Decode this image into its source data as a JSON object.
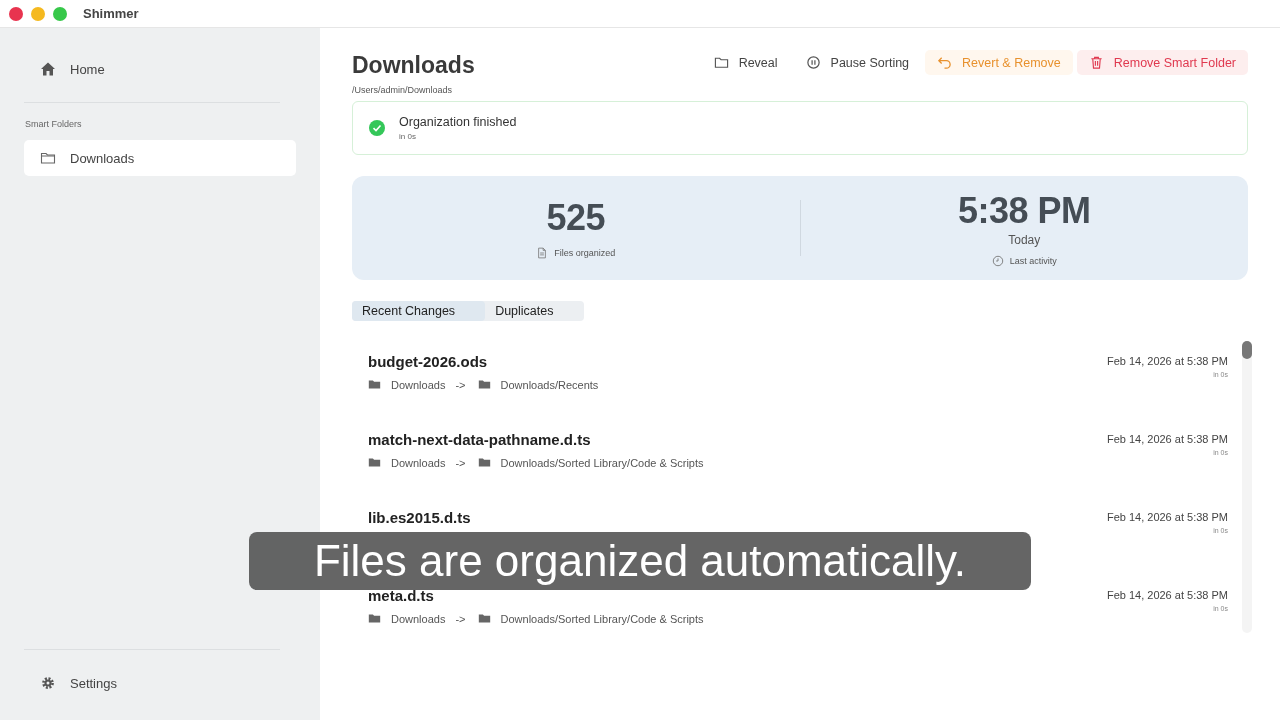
{
  "window": {
    "title": "Shimmer"
  },
  "sidebar": {
    "items": [
      {
        "label": "Home",
        "kind": "home",
        "selected": false
      }
    ],
    "section_title": "Smart Folders",
    "folders": [
      {
        "label": "Downloads",
        "selected": true
      }
    ],
    "footer": {
      "label": "Settings"
    }
  },
  "header": {
    "title": "Downloads",
    "path": "/Users/admin/Downloads"
  },
  "actions": [
    {
      "label": "Reveal",
      "kind": "folder"
    },
    {
      "label": "Pause Sorting",
      "kind": "pause"
    },
    {
      "label": "Revert & Remove",
      "kind": "revert"
    },
    {
      "label": "Remove Smart Folder",
      "kind": "delete"
    }
  ],
  "status": {
    "title": "Organization finished",
    "detail": "in 0s"
  },
  "stats": [
    {
      "value": "525",
      "label": "Files organized",
      "kind": "files"
    },
    {
      "value": "5:38 PM",
      "sublabel": "Today",
      "label": "Last activity",
      "kind": "clock"
    }
  ],
  "tabs": [
    {
      "label": "Recent Changes",
      "selected": true
    },
    {
      "label": "Duplicates",
      "selected": false
    }
  ],
  "changes": [
    {
      "name": "budget-2026.ods",
      "from": "Downloads",
      "arrow": "->",
      "to": "Downloads/Recents",
      "time": "Feb 14, 2026 at 5:38 PM",
      "duration": "in 0s"
    },
    {
      "name": "match-next-data-pathname.d.ts",
      "from": "Downloads",
      "arrow": "->",
      "to": "Downloads/Sorted Library/Code & Scripts",
      "time": "Feb 14, 2026 at 5:38 PM",
      "duration": "in 0s"
    },
    {
      "name": "lib.es2015.d.ts",
      "time": "Feb 14, 2026 at 5:38 PM",
      "duration": "in 0s"
    },
    {
      "name": "meta.d.ts",
      "from": "Downloads",
      "arrow": "->",
      "to": "Downloads/Sorted Library/Code & Scripts",
      "time": "Feb 14, 2026 at 5:38 PM",
      "duration": "in 0s"
    }
  ],
  "caption": "Files are organized automatically."
}
